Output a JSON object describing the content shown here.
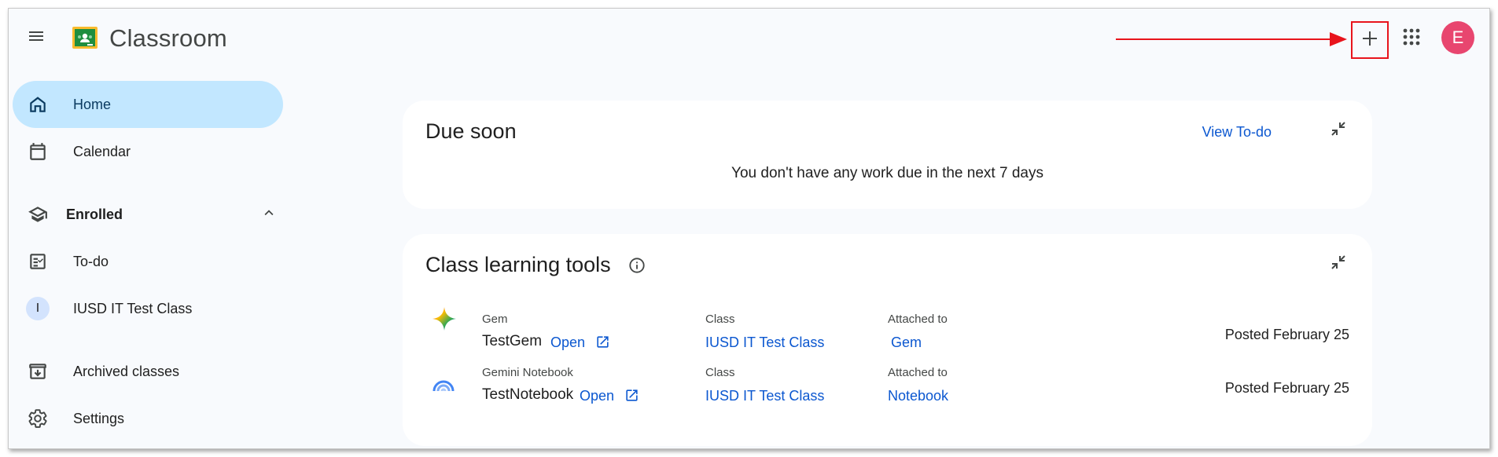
{
  "app": {
    "title": "Classroom",
    "avatar_letter": "E"
  },
  "topbar": {
    "menu_icon": "menu-icon",
    "add_icon": "plus-icon",
    "apps_icon": "apps-grid-icon"
  },
  "sidebar": {
    "items": [
      {
        "label": "Home",
        "icon": "home-icon",
        "active": true
      },
      {
        "label": "Calendar",
        "icon": "calendar-icon"
      }
    ],
    "enrolled": {
      "label": "Enrolled",
      "icon": "graduation-cap-icon"
    },
    "enrolled_items": [
      {
        "label": "To-do",
        "icon": "todo-list-icon"
      },
      {
        "label": "IUSD IT Test Class",
        "initial": "I"
      }
    ],
    "bottom_items": [
      {
        "label": "Archived classes",
        "icon": "archive-icon"
      },
      {
        "label": "Settings",
        "icon": "gear-icon"
      }
    ]
  },
  "due_soon": {
    "title": "Due soon",
    "view_todo": "View To-do",
    "empty_message": "You don't have any work due in the next 7 days"
  },
  "learning_tools": {
    "title": "Class learning tools",
    "rows": [
      {
        "type_label": "Gem",
        "name": "TestGem",
        "open_label": "Open",
        "class_label": "Class",
        "class_name": "IUSD IT Test Class",
        "attached_label": "Attached to",
        "attached_name": "Gem",
        "posted": "Posted February 25"
      },
      {
        "type_label": "Gemini Notebook",
        "name": "TestNotebook",
        "open_label": "Open",
        "class_label": "Class",
        "class_name": "IUSD IT Test Class",
        "attached_label": "Attached to",
        "attached_name": "Notebook",
        "posted": "Posted February 25"
      }
    ]
  },
  "colors": {
    "accent": "#0b57d0",
    "active_nav": "#c2e7ff",
    "annotation": "#e8141c",
    "avatar": "#e8466f"
  }
}
